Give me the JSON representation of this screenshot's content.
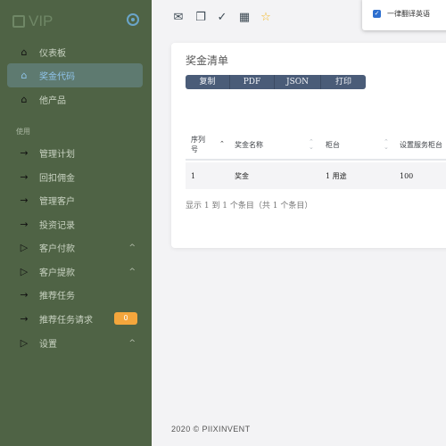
{
  "brand": {
    "text": "VIP"
  },
  "sidebar": {
    "items": [
      {
        "label": "仪表板",
        "icon": "home-icon",
        "glyph": "⌂"
      },
      {
        "label": "奖金代码",
        "icon": "home-icon",
        "glyph": "⌂",
        "active": true
      },
      {
        "label": "他产品",
        "icon": "home-icon",
        "glyph": "⌂"
      }
    ],
    "section_label": "使用",
    "section_items": [
      {
        "label": "管理计划",
        "icon": "arrow-right-icon",
        "glyph": "→"
      },
      {
        "label": "回扣佣金",
        "icon": "arrow-right-icon",
        "glyph": "→"
      },
      {
        "label": "管理客户",
        "icon": "arrow-right-icon",
        "glyph": "→"
      },
      {
        "label": "投资记录",
        "icon": "arrow-right-icon",
        "glyph": "→"
      },
      {
        "label": "客户付款",
        "icon": "play-icon",
        "glyph": "▷",
        "chevron": "^"
      },
      {
        "label": "客户提款",
        "icon": "play-icon",
        "glyph": "▷",
        "chevron": "^"
      },
      {
        "label": "推荐任务",
        "icon": "arrow-right-icon",
        "glyph": "→"
      },
      {
        "label": "推荐任务请求",
        "icon": "arrow-right-icon",
        "glyph": "→",
        "badge": "0"
      },
      {
        "label": "设置",
        "icon": "play-icon",
        "glyph": "▷",
        "chevron": "^"
      }
    ]
  },
  "topbar": {
    "icons": [
      {
        "name": "mail-icon",
        "glyph": "✉"
      },
      {
        "name": "chat-icon",
        "glyph": "❐"
      },
      {
        "name": "check-circle-icon",
        "glyph": "✓"
      },
      {
        "name": "calendar-icon",
        "glyph": "▦"
      },
      {
        "name": "star-icon",
        "glyph": "☆"
      }
    ]
  },
  "popup": {
    "label": "一律翻译英语",
    "checked": true
  },
  "card": {
    "title": "奖金清单",
    "buttons": [
      "复制",
      "PDF",
      "JSON",
      "打印"
    ],
    "columns": [
      {
        "label": "序列号",
        "sort": "up"
      },
      {
        "label": "奖金名称",
        "sort": "both"
      },
      {
        "label": "柜台",
        "sort": "both"
      },
      {
        "label": "设置服务柜台",
        "sort": "both"
      }
    ],
    "rows": [
      [
        "1",
        "奖金",
        "1 用途",
        "100"
      ]
    ],
    "info": "显示 1 到 1 个条目（共 1 个条目）"
  },
  "footer": {
    "text": "2020 © PIIXINVENT"
  },
  "colors": {
    "sidebar": "#4f6345",
    "active": "#5e7a70",
    "button": "#4a5c78",
    "badge": "#f4a63c",
    "star": "#f2b51b"
  }
}
